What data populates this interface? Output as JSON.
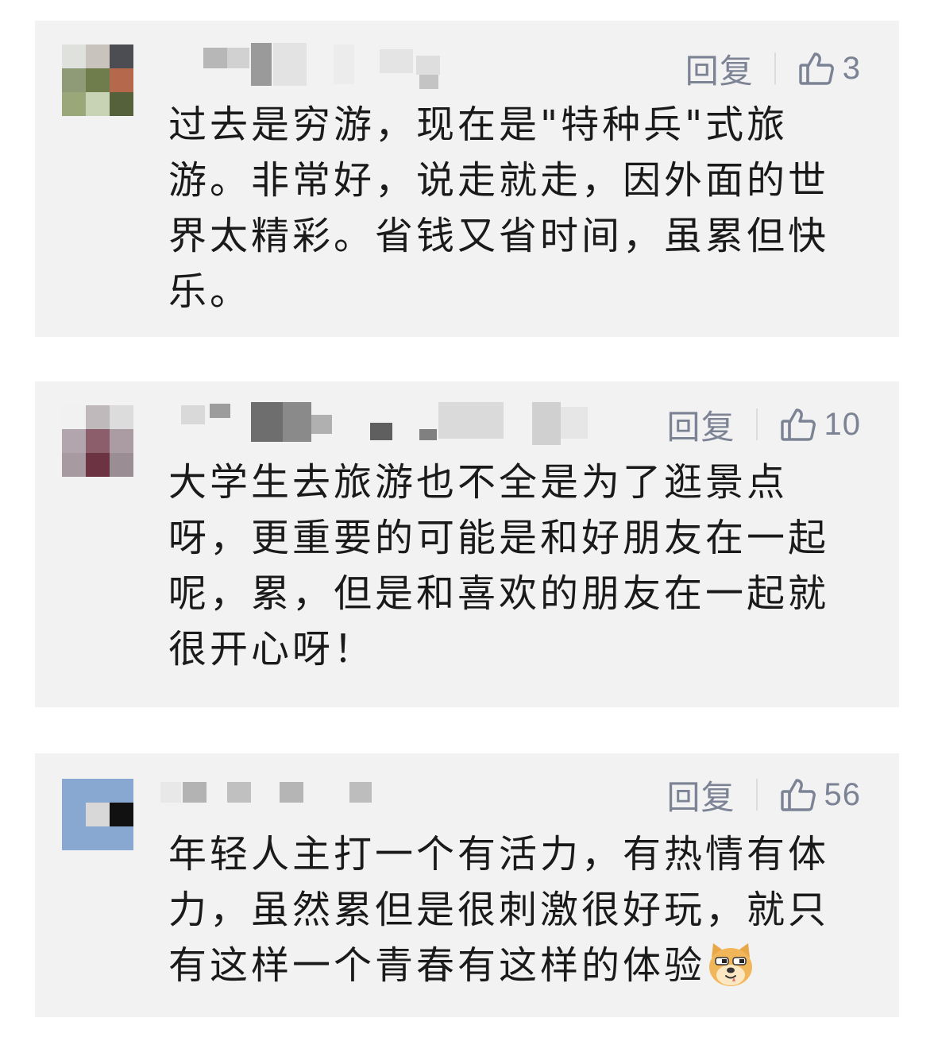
{
  "comments": [
    {
      "reply_label": "回复",
      "like_count": "3",
      "text": "过去是穷游，现在是\"特种兵\"式旅游。非常好，说走就走，因外面的世界太精彩。省钱又省时间，虽累但快乐。"
    },
    {
      "reply_label": "回复",
      "like_count": "10",
      "text": "大学生去旅游也不全是为了逛景点呀，更重要的可能是和好朋友在一起呢，累，但是和喜欢的朋友在一起就很开心呀！"
    },
    {
      "reply_label": "回复",
      "like_count": "56",
      "text": "年轻人主打一个有活力，有热情有体力，虽然累但是很刺激很好玩，就只有这样一个青春有这样的体验",
      "trailing_emoji": "doge-emoji"
    }
  ],
  "icons": {
    "like": "thumbs-up-outline-icon",
    "emoji": "doge-emoji-icon"
  },
  "colors": {
    "card_background": "#f2f2f2",
    "action_text": "#7b8394",
    "comment_text": "#1a1a1a"
  }
}
